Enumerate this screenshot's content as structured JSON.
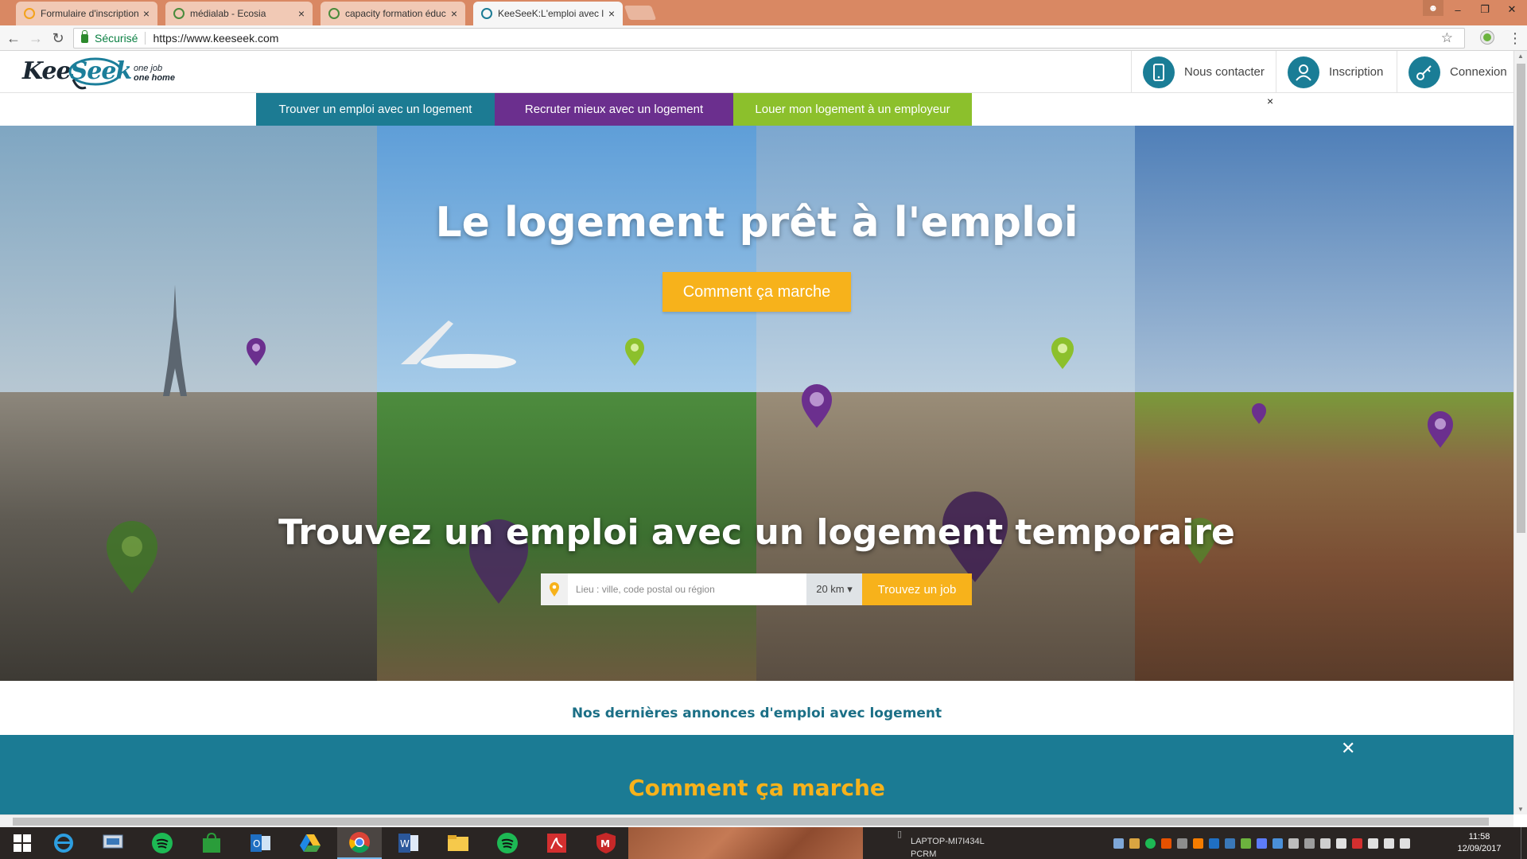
{
  "browser": {
    "tabs": [
      {
        "title": "Formulaire d'inscription -",
        "active": false
      },
      {
        "title": "médialab - Ecosia",
        "active": false
      },
      {
        "title": "capacity formation éduc",
        "active": false
      },
      {
        "title": "KeeSeeK:L'emploi avec lo",
        "active": true
      }
    ],
    "secure_label": "Sécurisé",
    "url": "https://www.keeseek.com",
    "window_controls": {
      "minimize": "–",
      "maximize": "❐",
      "close": "✕"
    }
  },
  "site": {
    "logo": {
      "part1": "Kee",
      "part2": "Seek",
      "tag_line1": "one job",
      "tag_line2": "one home"
    },
    "header": {
      "contact": "Nous contacter",
      "signup": "Inscription",
      "login": "Connexion"
    },
    "tabs": [
      {
        "label": "Trouver un emploi avec un logement",
        "color": "#1c7b93"
      },
      {
        "label": "Recruter mieux avec un logement",
        "color": "#6b2f8e"
      },
      {
        "label": "Louer mon logement à un employeur",
        "color": "#8cc02c"
      }
    ],
    "tabs_close": "×",
    "hero": {
      "title": "Le logement prêt à l'emploi",
      "cta": "Comment ça marche",
      "subtitle": "Trouvez un emploi avec un logement temporaire",
      "search_placeholder": "Lieu : ville, code postal ou région",
      "distance": "20 km ▾",
      "search_button": "Trouvez un job"
    },
    "annonces_title": "Nos dernières annonces d'emploi avec logement",
    "how": {
      "close": "✕",
      "title": "Comment ça marche"
    }
  },
  "taskbar": {
    "device_lines": [
      "LAPTOP-MI7I434L",
      "PCRM"
    ],
    "time": "11:58",
    "date": "12/09/2017"
  },
  "colors": {
    "teal": "#1b7b94",
    "purple": "#6b2f8e",
    "green": "#8cc02c",
    "orange": "#f7b21b"
  }
}
